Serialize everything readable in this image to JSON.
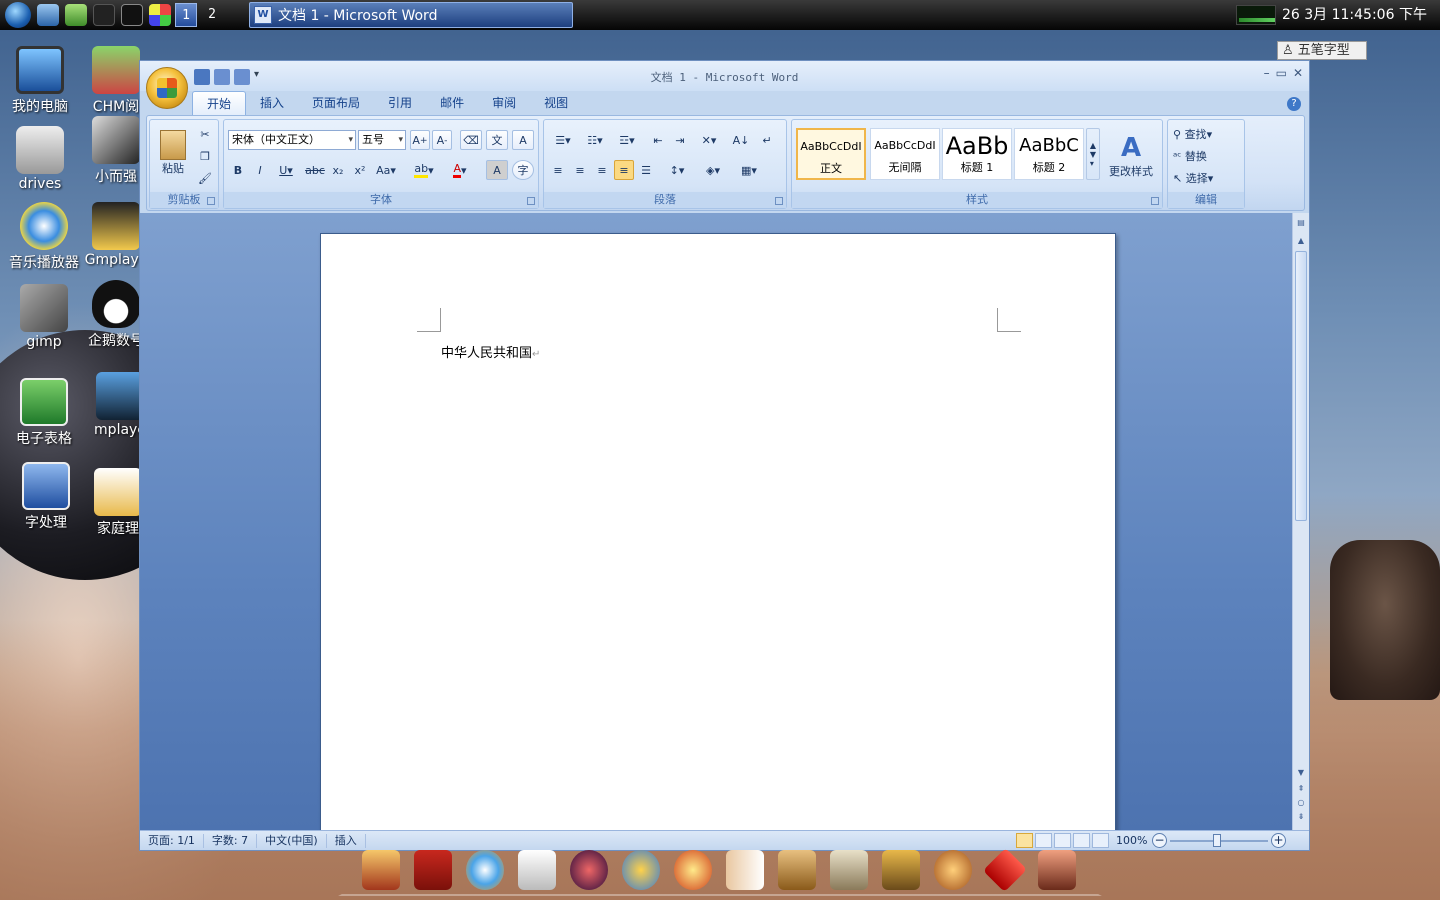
{
  "taskbar": {
    "workspaces": [
      "1",
      "2"
    ],
    "active_window": "文档 1 - Microsoft Word",
    "clock": "26  3月 11:45:06 下午",
    "ime": "五笔字型"
  },
  "desktop": {
    "icons": [
      "我的电脑",
      "CHM阅",
      "drives",
      "小而强",
      "音乐播放器",
      "Gmplaye",
      "gimp",
      "企鹅数号",
      "电子表格",
      "mplaye",
      "字处理",
      "家庭理"
    ]
  },
  "word": {
    "title": "文档 1 - Microsoft Word",
    "tabs": [
      "开始",
      "插入",
      "页面布局",
      "引用",
      "邮件",
      "审阅",
      "视图"
    ],
    "ribbon": {
      "clipboard": {
        "label": "剪贴板",
        "paste": "粘贴"
      },
      "font": {
        "label": "字体",
        "font_name": "宋体（中文正文）",
        "font_size": "五号"
      },
      "paragraph": {
        "label": "段落"
      },
      "styles": {
        "label": "样式",
        "items": [
          {
            "sample": "AaBbCcDdI",
            "name": "正文"
          },
          {
            "sample": "AaBbCcDdI",
            "name": "无间隔"
          },
          {
            "sample": "AaBb",
            "name": "标题 1"
          },
          {
            "sample": "AaBbC",
            "name": "标题 2"
          }
        ],
        "change": "更改样式"
      },
      "editing": {
        "label": "编辑",
        "find": "查找",
        "replace": "替换",
        "select": "选择"
      }
    },
    "document_text": "中华人民共和国",
    "status": {
      "page": "页面: 1/1",
      "words": "字数: 7",
      "lang": "中文(中国)",
      "mode": "插入",
      "zoom": "100%"
    }
  },
  "colors": {
    "ribbon_text": "#15428b",
    "selected_style": "#f0b64a"
  }
}
